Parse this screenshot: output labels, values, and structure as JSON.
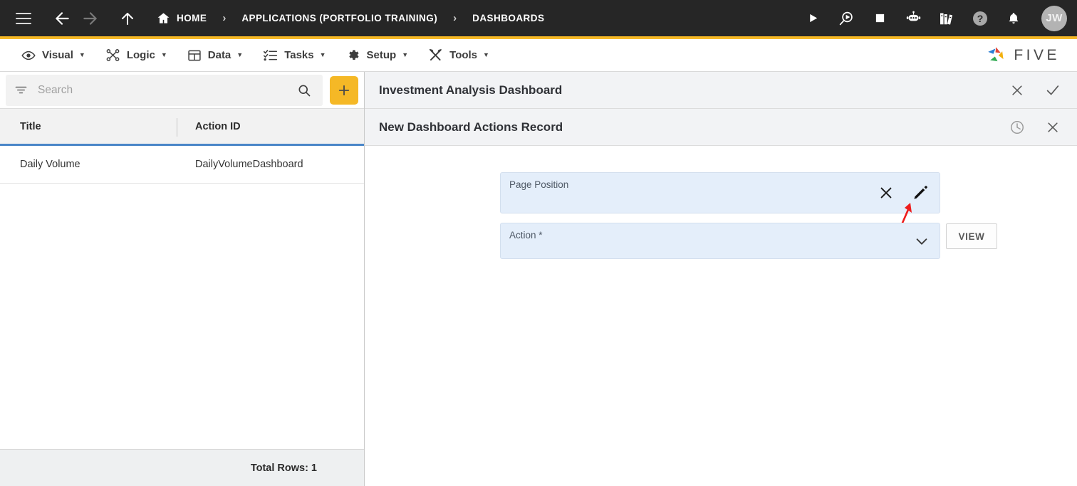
{
  "topbar": {
    "menu_icon": "hamburger-icon",
    "back_icon": "arrow-left-icon",
    "forward_icon": "arrow-right-icon",
    "up_icon": "arrow-up-icon",
    "breadcrumb": [
      {
        "label": "HOME",
        "icon": "home-icon"
      },
      {
        "label": "APPLICATIONS (PORTFOLIO TRAINING)",
        "icon": ""
      },
      {
        "label": "DASHBOARDS",
        "icon": ""
      }
    ],
    "separator": "›",
    "actions": [
      {
        "name": "run-icon",
        "title": "Run"
      },
      {
        "name": "debug-icon",
        "title": "Debug"
      },
      {
        "name": "stop-icon",
        "title": "Stop"
      },
      {
        "name": "chatbot-icon",
        "title": "Chat"
      },
      {
        "name": "library-icon",
        "title": "Library"
      },
      {
        "name": "help-icon",
        "title": "Help"
      },
      {
        "name": "bell-icon",
        "title": "Notifications"
      }
    ],
    "avatar_initials": "JW"
  },
  "menubar": {
    "items": [
      {
        "label": "Visual",
        "icon": "eye-icon",
        "caret": "▼"
      },
      {
        "label": "Logic",
        "icon": "logic-icon",
        "caret": "▼"
      },
      {
        "label": "Data",
        "icon": "table-icon",
        "caret": "▼"
      },
      {
        "label": "Tasks",
        "icon": "tasks-icon",
        "caret": "▼"
      },
      {
        "label": "Setup",
        "icon": "gear-icon",
        "caret": "▼"
      },
      {
        "label": "Tools",
        "icon": "tools-icon",
        "caret": "▼"
      }
    ],
    "logo_text": "FIVE"
  },
  "sidebar": {
    "search": {
      "placeholder": "Search",
      "value": "",
      "filter_icon": "filter-icon",
      "search_icon": "search-icon"
    },
    "add_button": {
      "label": "+",
      "name": "add-record-button"
    },
    "table": {
      "columns": [
        "Title",
        "Action ID"
      ],
      "rows": [
        {
          "title": "Daily Volume",
          "action_id": "DailyVolumeDashboard"
        }
      ]
    },
    "footer": {
      "total_rows_label": "Total Rows: 1"
    }
  },
  "main": {
    "primary_panel": {
      "title": "Investment Analysis Dashboard",
      "close_icon": "close-icon",
      "confirm_icon": "check-icon"
    },
    "secondary_panel": {
      "title": "New Dashboard Actions Record",
      "history_icon": "clock-icon",
      "close_icon": "close-icon"
    },
    "form": {
      "fields": [
        {
          "label": "Page Position",
          "value": "",
          "required": false,
          "clear_icon": "close-icon",
          "edit_icon": "pencil-icon"
        },
        {
          "label": "Action *",
          "value": "",
          "required": true,
          "dropdown_icon": "chevron-down-icon"
        }
      ],
      "view_button": "VIEW"
    },
    "annotation": {
      "type": "arrow",
      "color": "#ee1c1c",
      "points_to": "pencil-icon"
    }
  },
  "colors": {
    "topbar_bg": "#262626",
    "accent_yellow": "#F5B826",
    "field_blue": "#e4eefa",
    "table_underline": "#4a86c8",
    "annotation_red": "#ee1c1c"
  }
}
